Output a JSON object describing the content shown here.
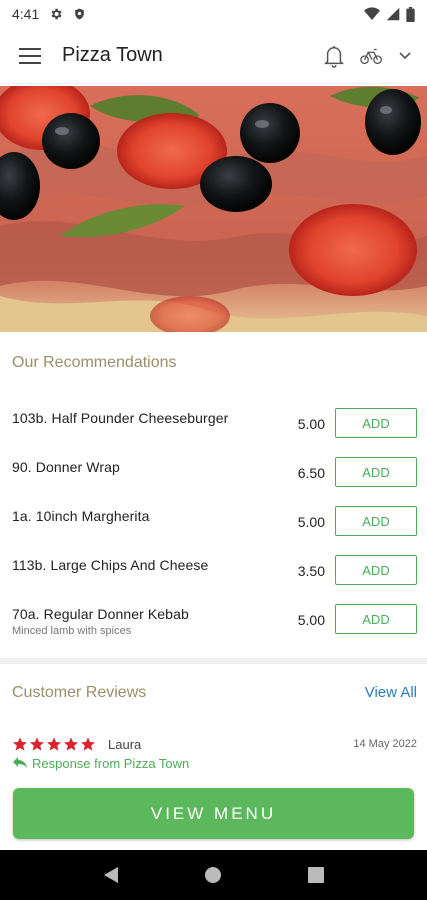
{
  "status_bar": {
    "time": "4:41",
    "icons": [
      "gear-icon",
      "shield-icon",
      "wifi-icon",
      "signal-icon",
      "battery-icon"
    ]
  },
  "app_bar": {
    "title": "Pizza Town",
    "icons": [
      "hamburger-menu-icon",
      "bell-icon",
      "bikes-icon",
      "chevron-down-icon"
    ]
  },
  "hero": {
    "image": "pizza-photo"
  },
  "recommendations": {
    "title": "Our Recommendations",
    "add_label": "ADD",
    "items": [
      {
        "name": "103b. Half Pounder Cheeseburger",
        "description": "",
        "price": "5.00"
      },
      {
        "name": "90. Donner Wrap",
        "description": "",
        "price": "6.50"
      },
      {
        "name": "1a. 10inch Margherita",
        "description": "",
        "price": "5.00"
      },
      {
        "name": "113b. Large Chips And Cheese",
        "description": "",
        "price": "3.50"
      },
      {
        "name": "70a. Regular Donner Kebab",
        "description": "Minced lamb with spices",
        "price": "5.00"
      }
    ]
  },
  "reviews": {
    "title": "Customer Reviews",
    "view_all_label": "View All",
    "items": [
      {
        "rating": 5,
        "author": "Laura",
        "date": "14 May 2022",
        "response_label": "Response from Pizza Town"
      }
    ]
  },
  "view_menu_label": "VIEW MENU",
  "colors": {
    "accent_green": "#5cb85c",
    "add_green": "#4cad58",
    "section_title": "#9a8f69",
    "link_blue": "#2c7bb6",
    "star_red": "#d9232d"
  },
  "nav_bar": {
    "icons": [
      "back-icon",
      "home-icon",
      "recents-icon"
    ]
  }
}
